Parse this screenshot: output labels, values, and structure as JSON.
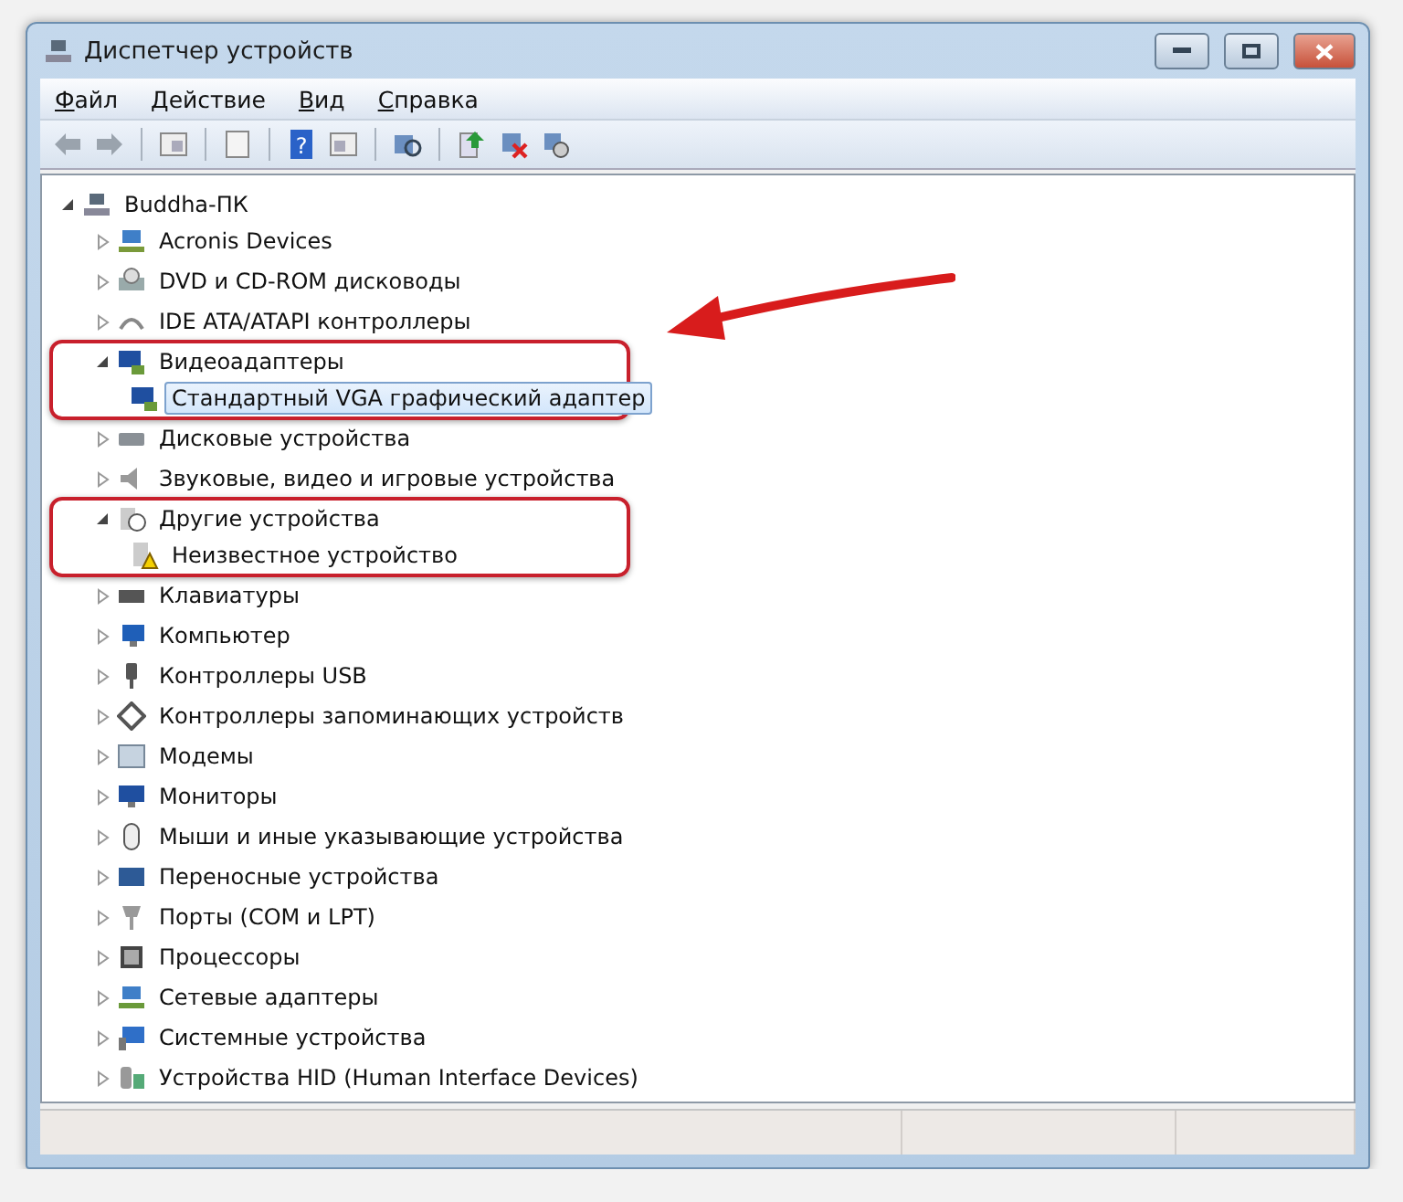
{
  "window": {
    "title": "Диспетчер устройств"
  },
  "menu": [
    {
      "label": "Файл"
    },
    {
      "label": "Действие"
    },
    {
      "label": "Вид"
    },
    {
      "label": "Справка"
    }
  ],
  "toolbar": {
    "help_glyph": "?"
  },
  "tree": {
    "label": "Buddha-ПК",
    "expanded": true,
    "selected": false,
    "children": [
      {
        "label": "Acronis Devices",
        "expanded": false,
        "selected": false,
        "highlighted": false
      },
      {
        "label": "DVD и CD-ROM дисководы",
        "expanded": false,
        "selected": false,
        "highlighted": false
      },
      {
        "label": "IDE ATA/ATAPI контроллеры",
        "expanded": false,
        "selected": false,
        "highlighted": false
      },
      {
        "label": "Видеоадаптеры",
        "expanded": true,
        "selected": false,
        "highlighted": true,
        "children": [
          {
            "label": "Стандартный VGA графический адаптер",
            "selected": true
          }
        ]
      },
      {
        "label": "Дисковые устройства",
        "expanded": false,
        "selected": false,
        "highlighted": false
      },
      {
        "label": "Звуковые, видео и игровые устройства",
        "expanded": false,
        "selected": false,
        "highlighted": false
      },
      {
        "label": "Другие устройства",
        "expanded": true,
        "selected": false,
        "highlighted": true,
        "children": [
          {
            "label": "Неизвестное устройство",
            "selected": false
          }
        ]
      },
      {
        "label": "Клавиатуры",
        "expanded": false,
        "selected": false,
        "highlighted": false
      },
      {
        "label": "Компьютер",
        "expanded": false,
        "selected": false,
        "highlighted": false
      },
      {
        "label": "Контроллеры USB",
        "expanded": false,
        "selected": false,
        "highlighted": false
      },
      {
        "label": "Контроллеры запоминающих устройств",
        "expanded": false,
        "selected": false,
        "highlighted": false
      },
      {
        "label": "Модемы",
        "expanded": false,
        "selected": false,
        "highlighted": false
      },
      {
        "label": "Мониторы",
        "expanded": false,
        "selected": false,
        "highlighted": false
      },
      {
        "label": "Мыши и иные указывающие устройства",
        "expanded": false,
        "selected": false,
        "highlighted": false
      },
      {
        "label": "Переносные устройства",
        "expanded": false,
        "selected": false,
        "highlighted": false
      },
      {
        "label": "Порты (COM и LPT)",
        "expanded": false,
        "selected": false,
        "highlighted": false
      },
      {
        "label": "Процессоры",
        "expanded": false,
        "selected": false,
        "highlighted": false
      },
      {
        "label": "Сетевые адаптеры",
        "expanded": false,
        "selected": false,
        "highlighted": false
      },
      {
        "label": "Системные устройства",
        "expanded": false,
        "selected": false,
        "highlighted": false
      },
      {
        "label": "Устройства HID (Human Interface Devices)",
        "expanded": false,
        "selected": false,
        "highlighted": false
      }
    ]
  }
}
